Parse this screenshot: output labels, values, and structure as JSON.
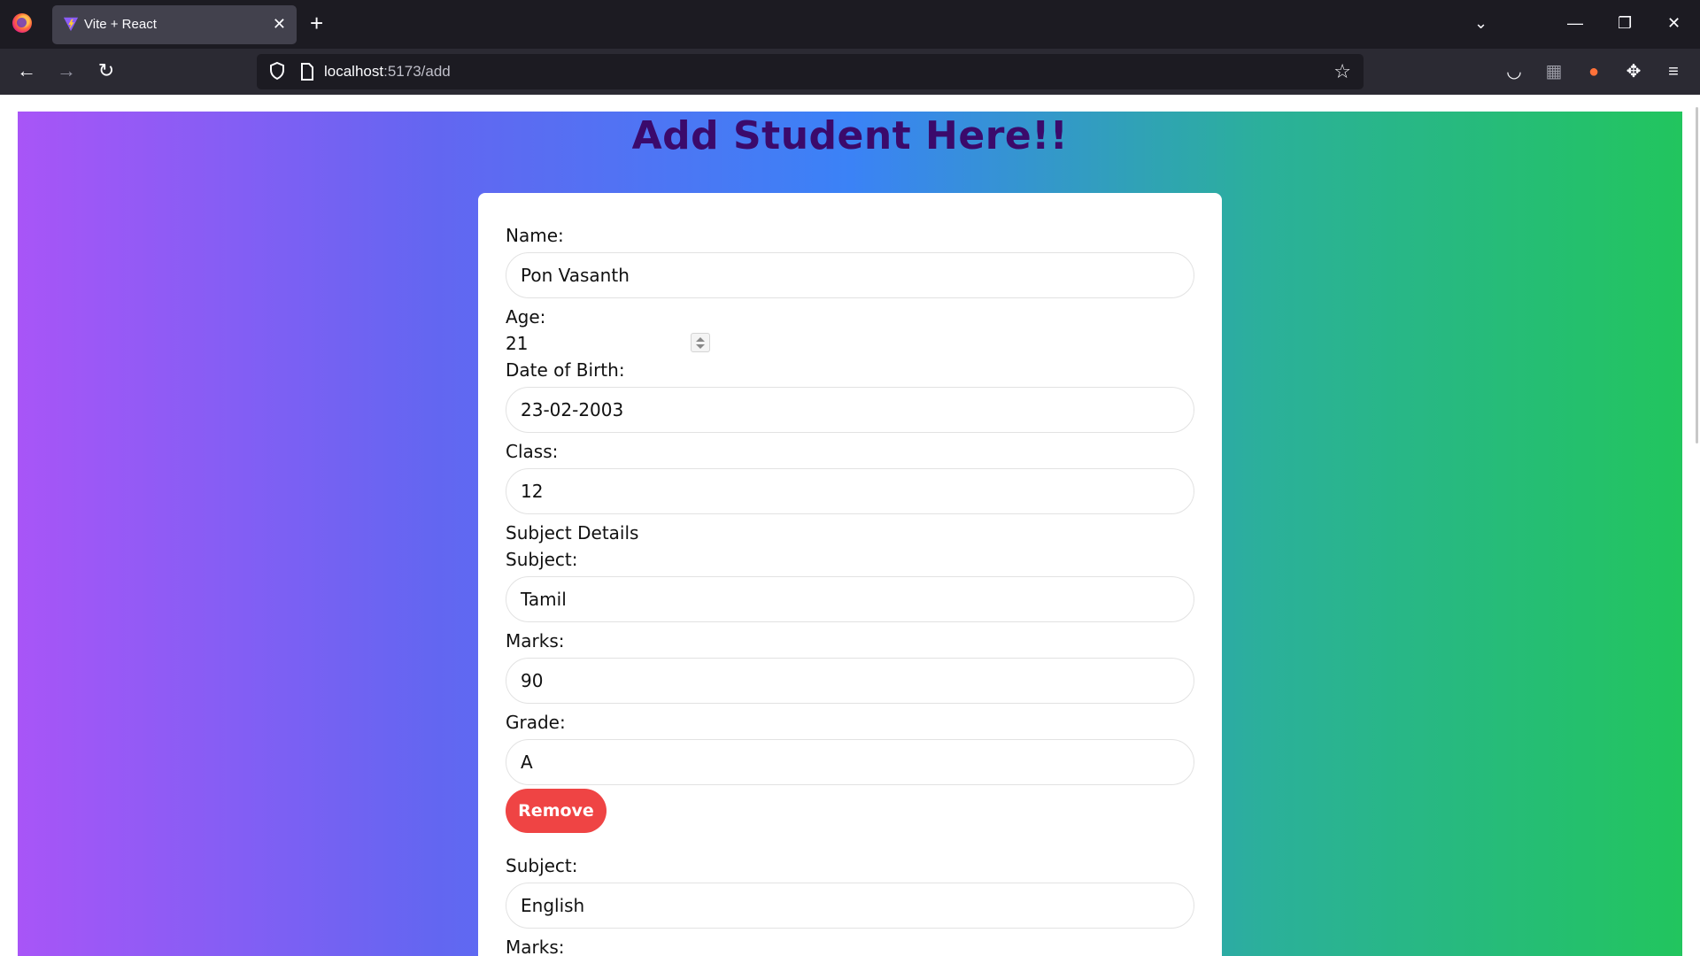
{
  "browser": {
    "tab_title": "Vite + React",
    "tab_close": "✕",
    "new_tab": "+",
    "url_host": "localhost",
    "url_path": ":5173/add",
    "window_controls": {
      "list": "⌄",
      "minimize": "—",
      "restore": "❐",
      "close": "✕"
    },
    "nav": {
      "back": "←",
      "forward": "→",
      "reload": "↻"
    },
    "icons": [
      "pocket-icon",
      "container-icon",
      "fox-extension-icon",
      "extensions-icon",
      "menu-icon"
    ]
  },
  "page": {
    "title": "Add Student Here!!",
    "colors": {
      "gradient_start": "#a855f7",
      "gradient_mid": "#3b82f6",
      "gradient_end": "#22c55e",
      "title": "#3b0a6b",
      "remove": "#ef4444"
    }
  },
  "form": {
    "name_label": "Name:",
    "name_value": "Pon Vasanth",
    "age_label": "Age:",
    "age_value": "21",
    "dob_label": "Date of Birth:",
    "dob_value": "23-02-2003",
    "class_label": "Class:",
    "class_value": "12",
    "subject_details_label": "Subject Details",
    "subjects": [
      {
        "subject_label": "Subject:",
        "subject_value": "Tamil",
        "marks_label": "Marks:",
        "marks_value": "90",
        "grade_label": "Grade:",
        "grade_value": "A",
        "remove_label": "Remove"
      },
      {
        "subject_label": "Subject:",
        "subject_value": "English",
        "marks_label": "Marks:"
      }
    ]
  }
}
